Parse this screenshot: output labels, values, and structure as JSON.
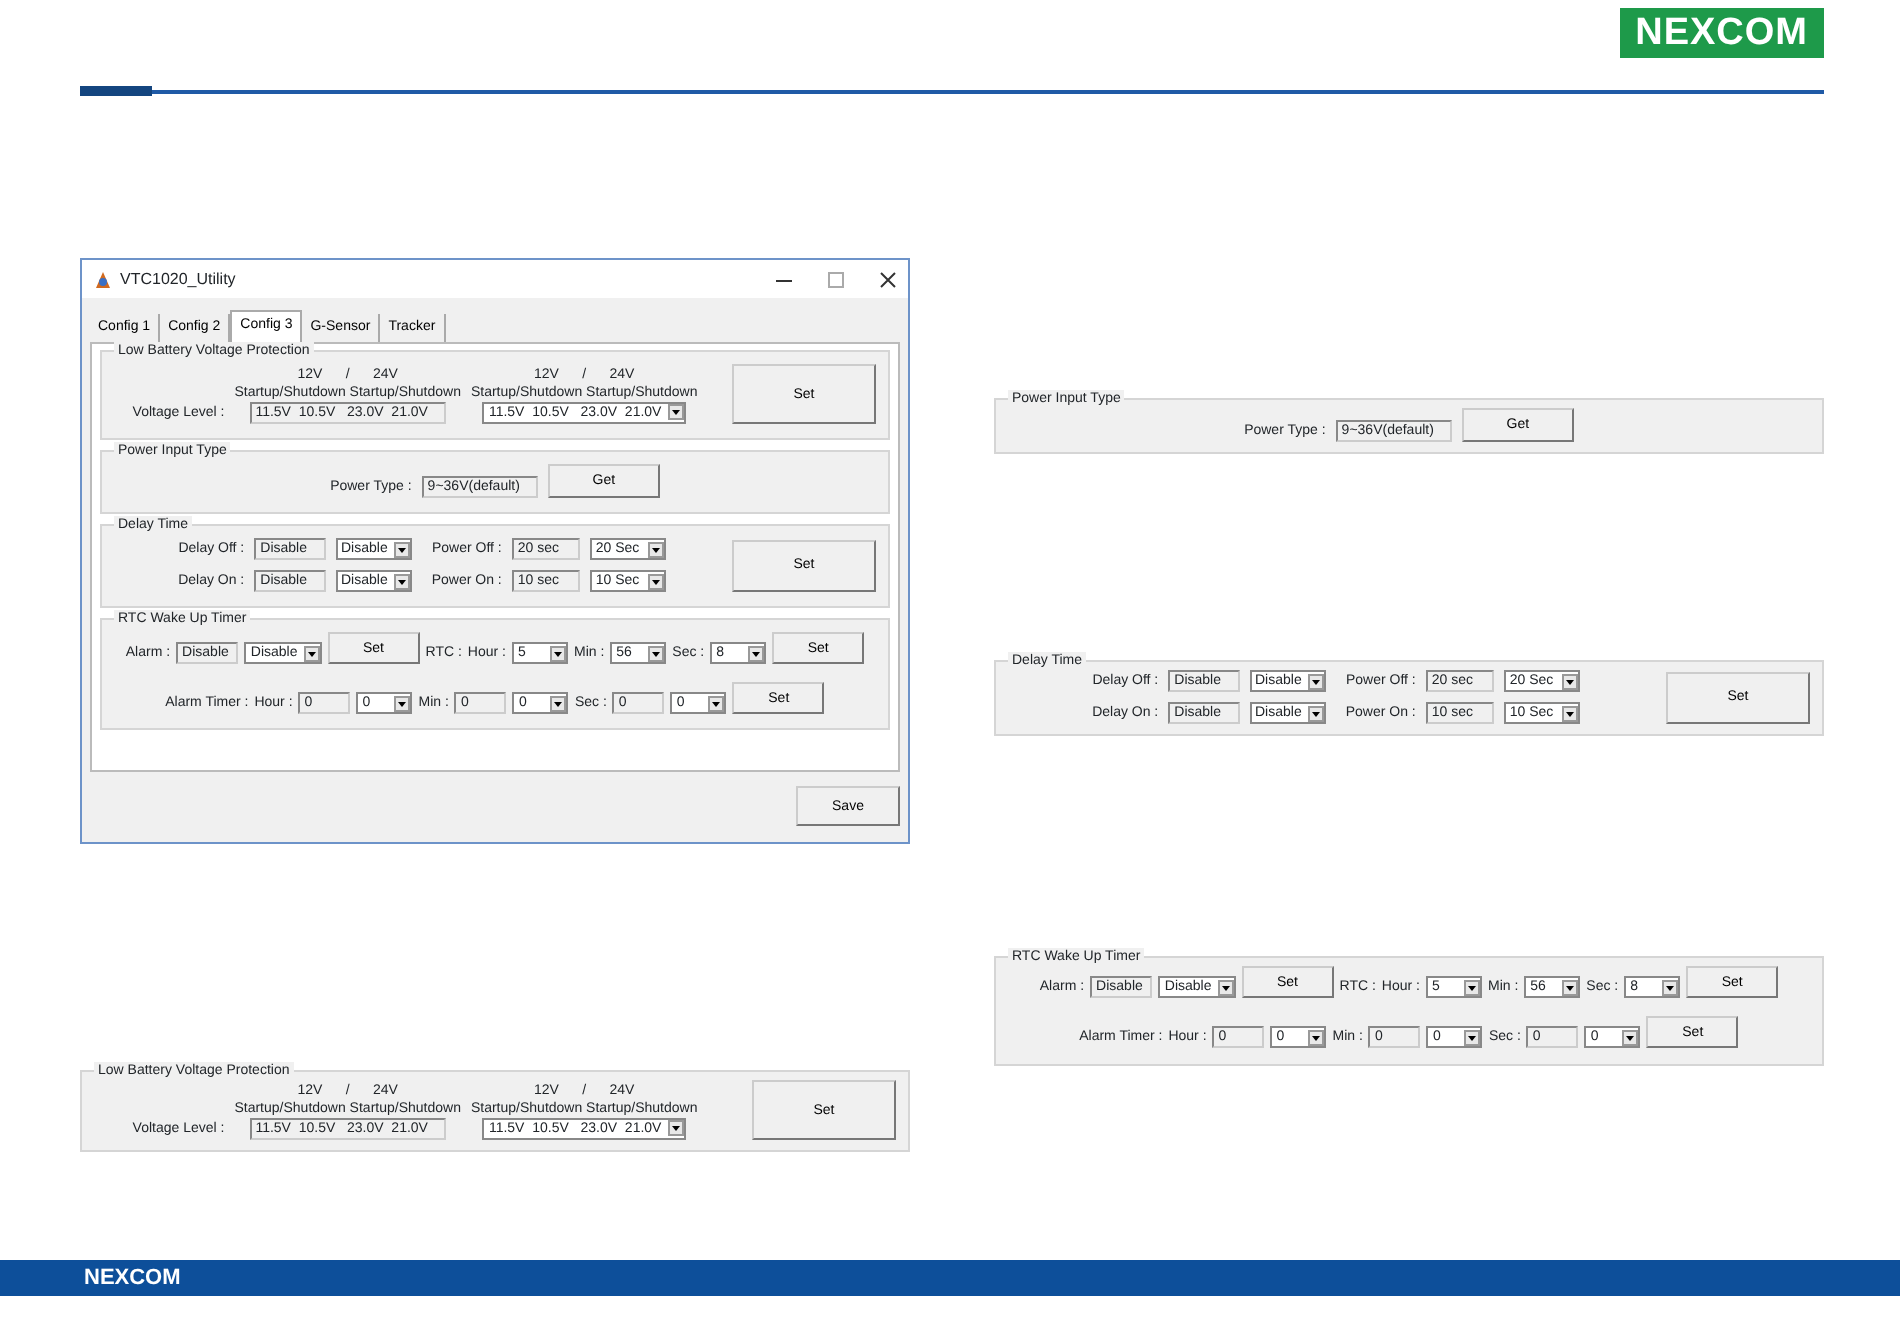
{
  "header": {
    "logo": "NEXCOM"
  },
  "window": {
    "title": "VTC1020_Utility",
    "tabs": [
      {
        "label": "Config 1",
        "selected": false
      },
      {
        "label": "Config 2",
        "selected": false
      },
      {
        "label": "Config 3",
        "selected": true
      },
      {
        "label": "G-Sensor",
        "selected": false
      },
      {
        "label": "Tracker",
        "selected": false
      }
    ],
    "groups": [
      {
        "kind": "voltage",
        "title": "Low Battery Voltage Protection",
        "side_button": "Set",
        "lines": [
          {
            "items": [
              {
                "kind": "label",
                "text": "Voltage Level :"
              },
              {
                "kind": "readout",
                "caption": [
                  "12V      /      24V",
                  "Startup/Shutdown Startup/Shutdown"
                ],
                "text": "11.5V  10.5V   23.0V  21.0V"
              },
              {
                "kind": "select",
                "caption": [
                  "12V      /      24V",
                  "Startup/Shutdown Startup/Shutdown"
                ],
                "text": "11.5V  10.5V   23.0V  21.0V"
              }
            ]
          }
        ]
      },
      {
        "kind": "power",
        "title": "Power Input Type",
        "lines": [
          {
            "items": [
              {
                "kind": "label",
                "text": "Power Type :"
              },
              {
                "kind": "readout",
                "text": "9~36V(default)"
              },
              {
                "kind": "button",
                "text": "Get"
              }
            ]
          }
        ]
      },
      {
        "kind": "delay",
        "title": "Delay Time",
        "side_button": "Set",
        "lines": [
          {
            "items": [
              {
                "kind": "label",
                "text": "Delay Off :"
              },
              {
                "kind": "readout",
                "text": "Disable"
              },
              {
                "kind": "select",
                "text": "Disable"
              },
              {
                "kind": "label",
                "text": "Power Off :"
              },
              {
                "kind": "readout",
                "text": "20 sec"
              },
              {
                "kind": "select",
                "text": "20 Sec"
              }
            ]
          },
          {
            "items": [
              {
                "kind": "label",
                "text": "Delay On :"
              },
              {
                "kind": "readout",
                "text": "Disable"
              },
              {
                "kind": "select",
                "text": "Disable"
              },
              {
                "kind": "label",
                "text": "Power On :"
              },
              {
                "kind": "readout",
                "text": "10 sec"
              },
              {
                "kind": "select",
                "text": "10 Sec"
              }
            ]
          }
        ]
      },
      {
        "kind": "rtc",
        "title": "RTC Wake Up Timer",
        "lines": [
          {
            "items": [
              {
                "kind": "label",
                "text": "Alarm :"
              },
              {
                "kind": "readout",
                "text": "Disable"
              },
              {
                "kind": "select",
                "text": "Disable"
              },
              {
                "kind": "button",
                "text": "Set"
              },
              {
                "kind": "label",
                "text": "RTC :"
              },
              {
                "kind": "label",
                "text": "Hour :"
              },
              {
                "kind": "select",
                "text": "5"
              },
              {
                "kind": "label",
                "text": "Min :"
              },
              {
                "kind": "select",
                "text": "56"
              },
              {
                "kind": "label",
                "text": "Sec :"
              },
              {
                "kind": "select",
                "text": "8"
              },
              {
                "kind": "button",
                "text": "Set"
              }
            ]
          },
          {
            "items": [
              {
                "kind": "label",
                "text": "Alarm Timer :"
              },
              {
                "kind": "label",
                "text": "Hour :"
              },
              {
                "kind": "readout",
                "text": "0"
              },
              {
                "kind": "select",
                "text": "0"
              },
              {
                "kind": "label",
                "text": "Min :"
              },
              {
                "kind": "readout",
                "text": "0"
              },
              {
                "kind": "select",
                "text": "0"
              },
              {
                "kind": "label",
                "text": "Sec :"
              },
              {
                "kind": "readout",
                "text": "0"
              },
              {
                "kind": "select",
                "text": "0"
              },
              {
                "kind": "button",
                "text": "Set"
              }
            ]
          }
        ]
      }
    ],
    "save_button": "Save"
  },
  "panels": [
    {
      "kind": "voltage",
      "title": "Low Battery Voltage Protection",
      "side_button": "Set",
      "lines": [
        {
          "items": [
            {
              "kind": "label",
              "text": "Voltage Level :"
            },
            {
              "kind": "readout",
              "caption": [
                "12V      /      24V",
                "Startup/Shutdown Startup/Shutdown"
              ],
              "text": "11.5V  10.5V   23.0V  21.0V"
            },
            {
              "kind": "select",
              "caption": [
                "12V      /      24V",
                "Startup/Shutdown Startup/Shutdown"
              ],
              "text": "11.5V  10.5V   23.0V  21.0V"
            }
          ]
        }
      ]
    },
    {
      "kind": "power",
      "title": "Power Input Type",
      "lines": [
        {
          "items": [
            {
              "kind": "label",
              "text": "Power Type :"
            },
            {
              "kind": "readout",
              "text": "9~36V(default)"
            },
            {
              "kind": "button",
              "text": "Get"
            }
          ]
        }
      ]
    },
    {
      "kind": "delay",
      "title": "Delay Time",
      "side_button": "Set",
      "lines": [
        {
          "items": [
            {
              "kind": "label",
              "text": "Delay Off :"
            },
            {
              "kind": "readout",
              "text": "Disable"
            },
            {
              "kind": "select",
              "text": "Disable"
            },
            {
              "kind": "label",
              "text": "Power Off :"
            },
            {
              "kind": "readout",
              "text": "20 sec"
            },
            {
              "kind": "select",
              "text": "20 Sec"
            }
          ]
        },
        {
          "items": [
            {
              "kind": "label",
              "text": "Delay On :"
            },
            {
              "kind": "readout",
              "text": "Disable"
            },
            {
              "kind": "select",
              "text": "Disable"
            },
            {
              "kind": "label",
              "text": "Power On :"
            },
            {
              "kind": "readout",
              "text": "10 sec"
            },
            {
              "kind": "select",
              "text": "10 Sec"
            }
          ]
        }
      ]
    },
    {
      "kind": "rtc",
      "title": "RTC Wake Up Timer",
      "lines": [
        {
          "items": [
            {
              "kind": "label",
              "text": "Alarm :"
            },
            {
              "kind": "readout",
              "text": "Disable"
            },
            {
              "kind": "select",
              "text": "Disable"
            },
            {
              "kind": "button",
              "text": "Set"
            },
            {
              "kind": "label",
              "text": "RTC :"
            },
            {
              "kind": "label",
              "text": "Hour :"
            },
            {
              "kind": "select",
              "text": "5"
            },
            {
              "kind": "label",
              "text": "Min :"
            },
            {
              "kind": "select",
              "text": "56"
            },
            {
              "kind": "label",
              "text": "Sec :"
            },
            {
              "kind": "select",
              "text": "8"
            },
            {
              "kind": "button",
              "text": "Set"
            }
          ]
        },
        {
          "items": [
            {
              "kind": "label",
              "text": "Alarm Timer :"
            },
            {
              "kind": "label",
              "text": "Hour :"
            },
            {
              "kind": "readout",
              "text": "0"
            },
            {
              "kind": "select",
              "text": "0"
            },
            {
              "kind": "label",
              "text": "Min :"
            },
            {
              "kind": "readout",
              "text": "0"
            },
            {
              "kind": "select",
              "text": "0"
            },
            {
              "kind": "label",
              "text": "Sec :"
            },
            {
              "kind": "readout",
              "text": "0"
            },
            {
              "kind": "select",
              "text": "0"
            },
            {
              "kind": "button",
              "text": "Set"
            }
          ]
        }
      ]
    }
  ],
  "footer": {
    "logo": "NEXCOM"
  }
}
